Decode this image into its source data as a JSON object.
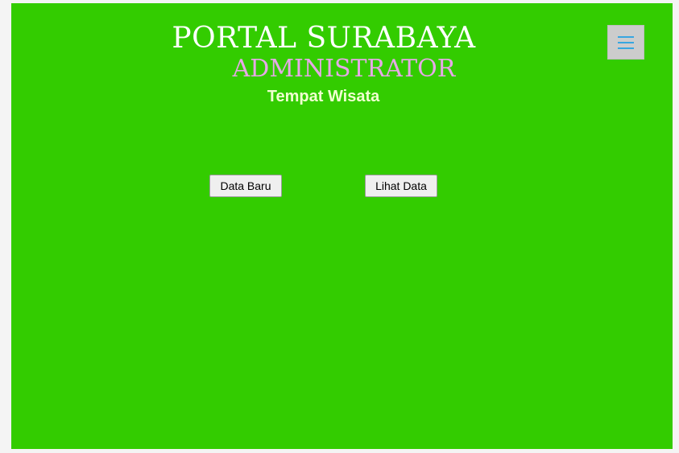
{
  "header": {
    "title": "PORTAL SURABAYA",
    "subtitle": "ADMINISTRATOR",
    "section": "Tempat Wisata"
  },
  "menu": {
    "icon": "hamburger-icon"
  },
  "actions": {
    "new_label": "Data Baru",
    "view_label": "Lihat Data"
  },
  "colors": {
    "background": "#33cc00",
    "title": "#ffffff",
    "subtitle": "#e6a8e6",
    "section": "#f0ffd0",
    "menu_bg": "#cccccc",
    "menu_icon": "#37a6e0"
  }
}
